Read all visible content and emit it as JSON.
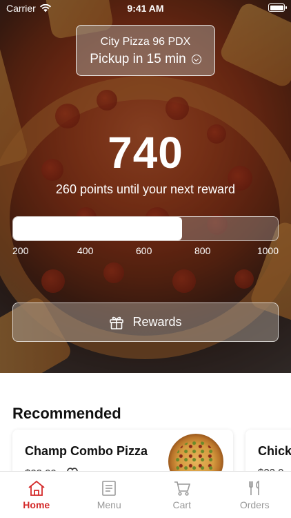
{
  "status_bar": {
    "carrier": "Carrier",
    "time": "9:41 AM"
  },
  "store": {
    "name": "City Pizza 96 PDX",
    "pickup": "Pickup in 15 min"
  },
  "rewards": {
    "points": "740",
    "subline": "260 points until your next reward",
    "progress_fraction": 0.637,
    "scale": [
      "200",
      "400",
      "600",
      "800",
      "1000"
    ],
    "button_label": "Rewards"
  },
  "recommended": {
    "title": "Recommended",
    "items": [
      {
        "name": "Champ Combo Pizza",
        "price": "$22.99"
      },
      {
        "name": "Chick",
        "price": "$22.9"
      }
    ]
  },
  "tabs": [
    {
      "label": "Home",
      "icon": "home-icon",
      "active": true
    },
    {
      "label": "Menu",
      "icon": "menu-icon",
      "active": false
    },
    {
      "label": "Cart",
      "icon": "cart-icon",
      "active": false
    },
    {
      "label": "Orders",
      "icon": "fork-knife-icon",
      "active": false
    }
  ],
  "colors": {
    "accent": "#d42a2a",
    "inactive": "#999999"
  }
}
